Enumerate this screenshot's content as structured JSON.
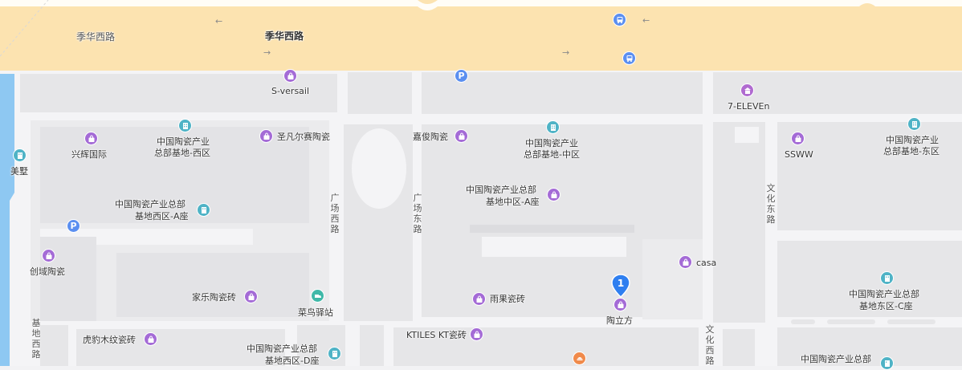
{
  "map": {
    "roads": {
      "jihua_west_left": "季华西路",
      "jihua_west_main": "季华西路",
      "guangchang_west": "广场西路",
      "guangchang_east": "广场东路",
      "wenhua_east": "文化东路",
      "wenhua_west": "文化西路",
      "jidi_west": "基地西路"
    },
    "pois": {
      "s_versail": "S-versail",
      "seven_eleven": "7-ELEVEn",
      "xinghui": "兴辉国际",
      "west_zone_line1": "中国陶瓷产业",
      "west_zone_line2": "总部基地-西区",
      "shengfanersai": "圣凡尔赛陶瓷",
      "jiajun": "嘉俊陶瓷",
      "mid_zone_line1": "中国陶瓷产业",
      "mid_zone_line2": "总部基地-中区",
      "ssww": "SSWW",
      "east_zone_line1": "中国陶瓷产业",
      "east_zone_line2": "总部基地-东区",
      "meishu": "美墅",
      "west_a_line1": "中国陶瓷产业总部",
      "west_a_line2": "基地西区-A座",
      "mid_a_line1": "中国陶瓷产业总部",
      "mid_a_line2": "基地中区-A座",
      "chuangyu": "创域陶瓷",
      "casa": "casa",
      "east_c_line1": "中国陶瓷产业总部",
      "east_c_line2": "基地东区-C座",
      "jiale": "家乐陶瓷砖",
      "cainiao": "菜鸟驿站",
      "yuguo": "雨果瓷砖",
      "taolifang": "陶立方",
      "hubao": "虎豹木纹瓷砖",
      "ktiles": "KTILES KT瓷砖",
      "west_d_line1": "中国陶瓷产业总部",
      "west_d_line2": "基地西区-D座",
      "east_bottom_line1": "中国陶瓷产业总部"
    },
    "marker_number": "1",
    "colors": {
      "main_road": "#fce3b0",
      "block": "#e6e6e8",
      "water": "#8ec8f2",
      "shop_icon": "#a46bd6",
      "office_icon": "#4fb3c6",
      "bus_icon": "#5b8ff0",
      "marker": "#2f7ff0"
    }
  }
}
